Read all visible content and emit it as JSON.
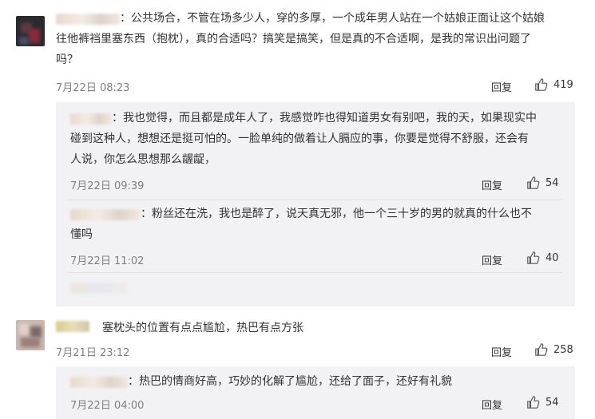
{
  "comments": [
    {
      "text_line1": "：公共场合，不管在场多少人，穿的多厚，一个成年男人站在一个姑娘正面让这个姑娘",
      "text_line2": "往他裤裆里塞东西（抱枕），真的合适吗？搞笑是搞笑，但是真的不合适啊，是我的常识出问题了",
      "text_line3": "吗？",
      "time": "7月22日 08:23",
      "reply": "回复",
      "likes": "419"
    },
    {
      "text": "塞枕头的位置有点点尴尬，热巴有点方张",
      "time": "7月21日 23:12",
      "reply": "回复",
      "likes": "258"
    }
  ],
  "replies": [
    {
      "text_line1": "：我也觉得，而且都是成年人了，我感觉咋也得知道男女有别吧，我的天，如果现实中",
      "text_line2": "碰到这种人，想想还是挺可怕的。一脸单纯的做着让人膈应的事，你要是觉得不舒服，还会有",
      "text_line3": "人说，你怎么思想那么龌龊，",
      "time": "7月22日 09:39",
      "reply": "回复",
      "likes": "54"
    },
    {
      "text_line1": "：粉丝还在洗，我也是醉了，说天真无邪，他一个三十岁的男的就真的什么也不",
      "text_line2": "懂吗",
      "time": "7月22日 11:02",
      "reply": "回复",
      "likes": "40"
    },
    {
      "text": "：热巴的情商好高，巧妙的化解了尴尬，还给了面子，还好有礼貌",
      "time": "7月22日 04:00",
      "reply": "回复",
      "likes": "54"
    }
  ],
  "icons": {
    "like": "thumbs-up-icon"
  },
  "colors": {
    "subbox_bg": "#f2f2f5",
    "time": "#808080",
    "text": "#333333"
  }
}
